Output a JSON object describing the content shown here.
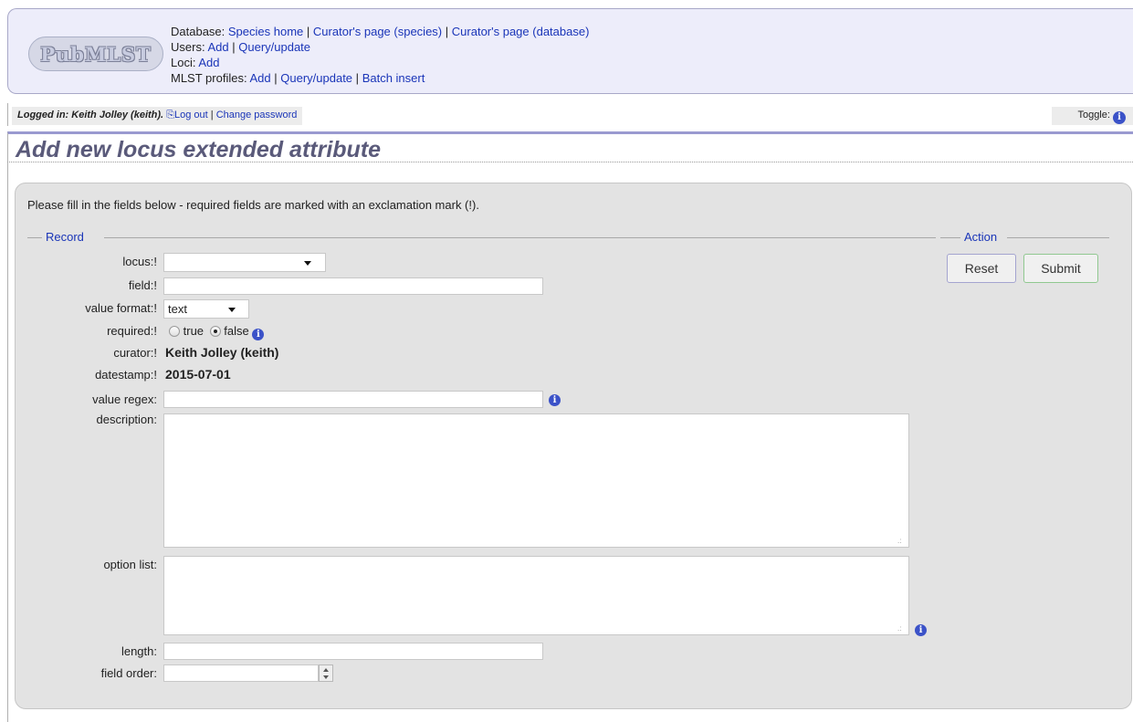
{
  "header": {
    "logo_text": "PubMLST",
    "database_label": "Database:",
    "database_links": [
      "Species home",
      "Curator's page (species)",
      "Curator's page (database)"
    ],
    "users_label": "Users:",
    "users_links": [
      "Add",
      "Query/update"
    ],
    "loci_label": "Loci:",
    "loci_links": [
      "Add"
    ],
    "mlst_label": "MLST profiles:",
    "mlst_links": [
      "Add",
      "Query/update",
      "Batch insert"
    ],
    "separator": "|"
  },
  "login_bar": {
    "logged_in_text": "Logged in: Keith Jolley (keith).",
    "logout_label": "Log out",
    "change_password_label": "Change password",
    "toggle_label": "Toggle:"
  },
  "page": {
    "title": "Add new locus extended attribute",
    "instructions": "Please fill in the fields below - required fields are marked with an exclamation mark (!)."
  },
  "form": {
    "record_legend": "Record",
    "action_legend": "Action",
    "labels": {
      "locus": "locus:!",
      "field": "field:!",
      "value_format": "value format:!",
      "required": "required:!",
      "curator": "curator:!",
      "datestamp": "datestamp:!",
      "value_regex": "value regex:",
      "description": "description:",
      "option_list": "option list:",
      "length": "length:",
      "field_order": "field order:"
    },
    "values": {
      "locus": "",
      "field": "",
      "value_format": "text",
      "required_options": [
        "true",
        "false"
      ],
      "required_selected": "false",
      "curator": "Keith Jolley (keith)",
      "datestamp": "2015-07-01",
      "value_regex": "",
      "description": "",
      "option_list": "",
      "length": "",
      "field_order": ""
    },
    "buttons": {
      "reset": "Reset",
      "submit": "Submit"
    }
  },
  "icons": {
    "info": "info-icon",
    "logout": "logout-icon"
  },
  "colors": {
    "link": "#1a35b8",
    "header_bg": "#ededfa",
    "panel_bg": "#e3e3e3",
    "title": "#5a5a7a",
    "info_icon": "#3b52c8"
  }
}
